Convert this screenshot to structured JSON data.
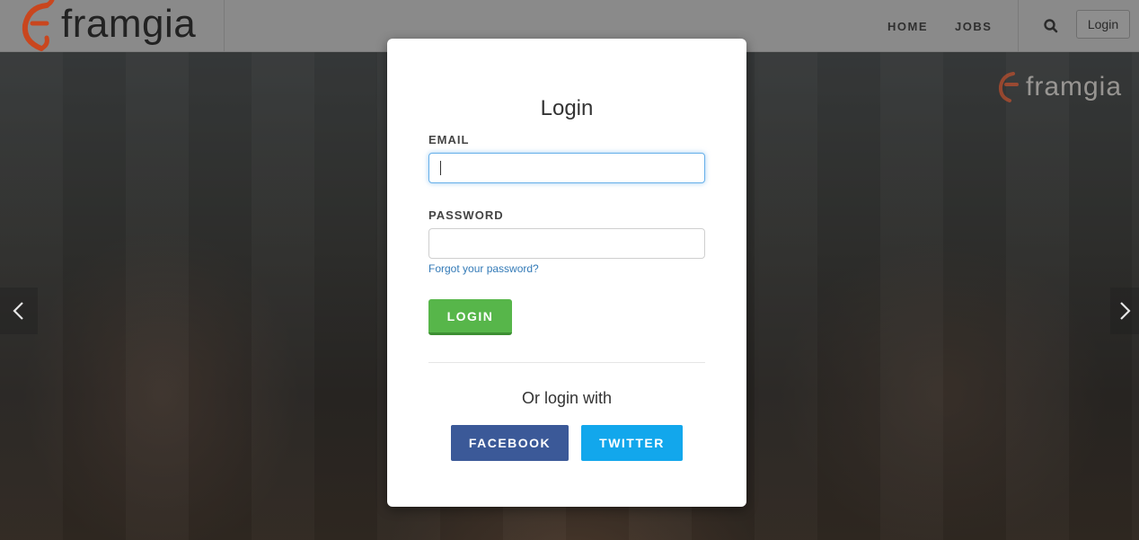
{
  "brand": {
    "name": "framgia"
  },
  "nav": {
    "home": "HOME",
    "jobs": "JOBS",
    "login": "Login",
    "search_icon": "search-icon"
  },
  "hero": {
    "watermark": "framgia"
  },
  "modal": {
    "title": "Login",
    "email_label": "EMAIL",
    "email_value": "",
    "password_label": "PASSWORD",
    "password_value": "",
    "forgot_link": "Forgot your password?",
    "login_button": "LOGIN",
    "or_text": "Or login with",
    "facebook_button": "FACEBOOK",
    "twitter_button": "TWITTER"
  },
  "colors": {
    "login_green": "#57b64a",
    "facebook_blue": "#3b5998",
    "twitter_blue": "#12a7ec",
    "link_blue": "#337ab7",
    "brand_orange": "#e8562a"
  }
}
